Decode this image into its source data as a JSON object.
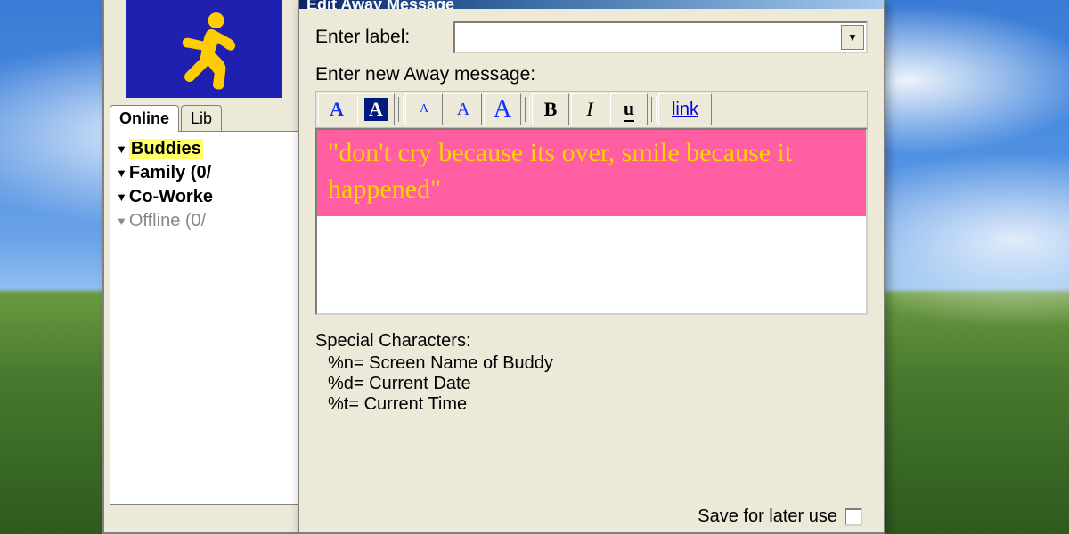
{
  "buddy_window": {
    "tabs": [
      "Online",
      "Lib"
    ],
    "active_tab": 0,
    "groups": [
      {
        "label": "Buddies",
        "selected": true,
        "bold": true
      },
      {
        "label": "Family (0/",
        "bold": true
      },
      {
        "label": "Co-Worke",
        "bold": true
      },
      {
        "label": "Offline (0/",
        "muted": true
      }
    ]
  },
  "dialog": {
    "title": "Edit Away Message",
    "enter_label": "Enter label:",
    "label_value": "",
    "enter_message": "Enter new Away message:",
    "toolbar": {
      "fgcolor": "A",
      "bgcolor": "A",
      "size_small": "A",
      "size_med": "A",
      "size_big": "A",
      "bold": "B",
      "italic": "I",
      "underline": "u",
      "link": "link"
    },
    "message_text": "\"don't cry because its over, smile because it happened\"",
    "special": {
      "header": "Special Characters:",
      "lines": [
        "%n= Screen Name of Buddy",
        "%d= Current Date",
        "%t= Current Time"
      ]
    },
    "save_label": "Save for later use",
    "save_checked": false
  }
}
